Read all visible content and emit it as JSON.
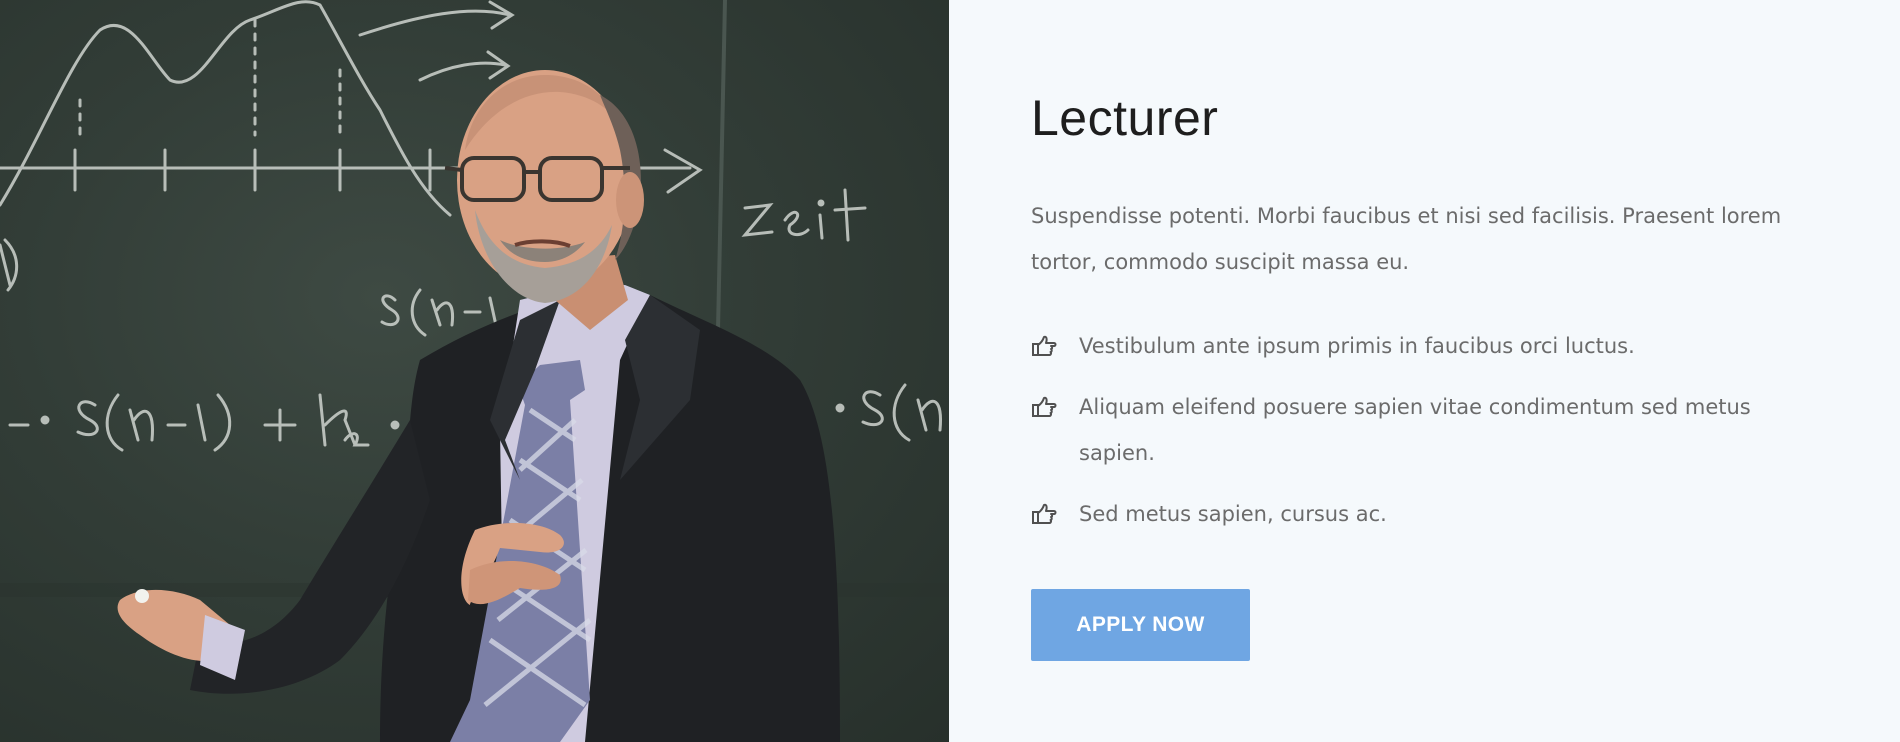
{
  "photo": {
    "icon": "lecturer-photo"
  },
  "content": {
    "title": "Lecturer",
    "intro": "Suspendisse potenti. Morbi faucibus et nisi sed facilisis. Praesent lorem tortor, commodo suscipit massa eu.",
    "features": [
      {
        "icon": "hand-pointing-right-icon",
        "text": "Vestibulum ante ipsum primis in faucibus orci luctus."
      },
      {
        "icon": "hand-pointing-right-icon",
        "text": "Aliquam eleifend posuere sapien vitae condimentum sed metus sapien."
      },
      {
        "icon": "hand-pointing-right-icon",
        "text": "Sed metus sapien, cursus ac."
      }
    ],
    "apply_label": "APPLY NOW"
  },
  "colors": {
    "background": "#f5f9fc",
    "title": "#1e1e1e",
    "body_text": "#6b6b6b",
    "button": "#6fa6e3",
    "button_text": "#ffffff",
    "chalkboard": "#323d37"
  }
}
